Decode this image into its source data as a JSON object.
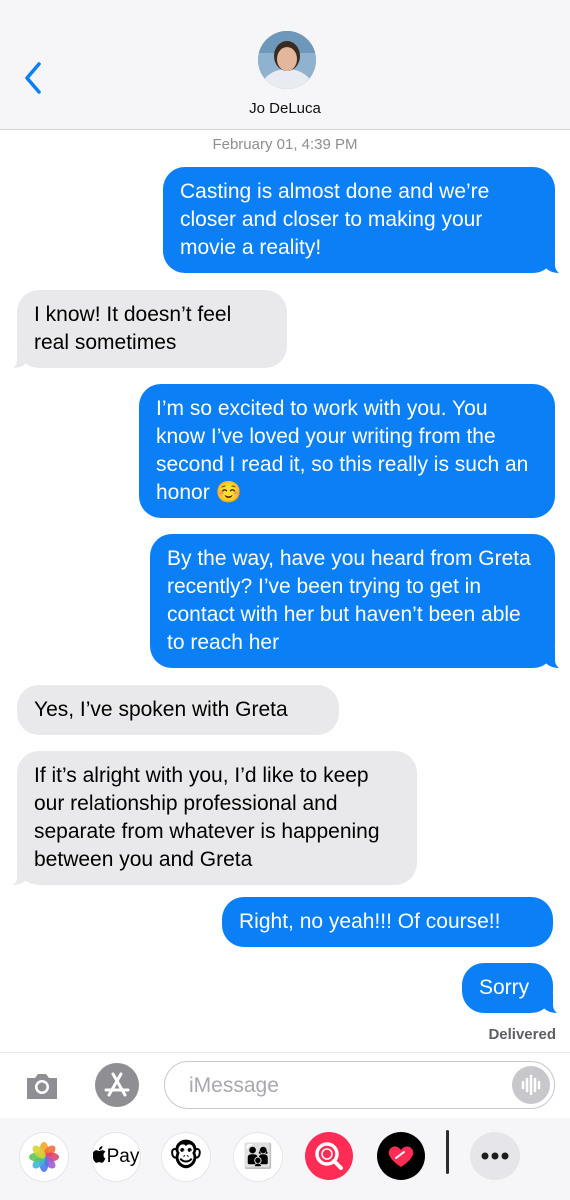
{
  "header": {
    "contact_name": "Jo DeLuca",
    "back_icon": "chevron-left-icon",
    "accent_color": "#0b7ff5"
  },
  "conversation": {
    "timestamp": "February 01, 4:39 PM",
    "messages": [
      {
        "direction": "sent",
        "text": "Casting is almost done and we’re closer and closer to making your movie a reality!"
      },
      {
        "direction": "received",
        "text": "I know! It doesn’t feel real sometimes"
      },
      {
        "direction": "sent",
        "text": "I’m so excited to work with you. You know I’ve loved your writing from the second I read it, so this really is such an honor ☺️"
      },
      {
        "direction": "sent",
        "text": "By the way, have you heard from Greta recently? I’ve been trying to get in contact with her but haven’t been able to reach her"
      },
      {
        "direction": "received",
        "text": "Yes, I’ve spoken with Greta"
      },
      {
        "direction": "received",
        "text": "If it’s alright with you, I’d like to keep our relationship professional and separate from whatever is happening between you and Greta"
      },
      {
        "direction": "sent",
        "text": "Right, no yeah!!! Of course!!"
      },
      {
        "direction": "sent",
        "text": "Sorry"
      }
    ],
    "status": "Delivered"
  },
  "composer": {
    "placeholder": "iMessage",
    "camera_icon": "camera-icon",
    "appstore_icon": "app-store-icon",
    "audio_icon": "audio-waveform-icon"
  },
  "app_drawer": {
    "items": [
      {
        "name": "photos-app-icon"
      },
      {
        "name": "apple-pay-app-icon",
        "label": "Pay"
      },
      {
        "name": "animoji-app-icon",
        "glyph": "🐵"
      },
      {
        "name": "memoji-app-icon",
        "glyph": "👨‍👩‍👦"
      },
      {
        "name": "images-search-app-icon"
      },
      {
        "name": "digital-touch-app-icon"
      },
      {
        "name": "more-apps-icon"
      }
    ]
  }
}
